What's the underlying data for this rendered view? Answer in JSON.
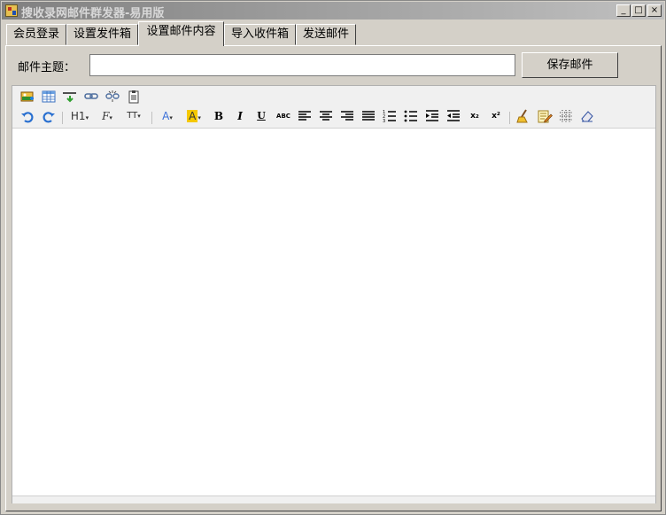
{
  "window": {
    "title": "搜收录网邮件群发器-易用版",
    "minimize_glyph": "_",
    "maximize_glyph": "□",
    "close_glyph": "×"
  },
  "tabs": [
    {
      "label": "会员登录",
      "active": false
    },
    {
      "label": "设置发件箱",
      "active": false
    },
    {
      "label": "设置邮件内容",
      "active": true
    },
    {
      "label": "导入收件箱",
      "active": false
    },
    {
      "label": "发送邮件",
      "active": false
    }
  ],
  "subject": {
    "label": "邮件主题：",
    "value": "",
    "placeholder": ""
  },
  "save_button": {
    "label": "保存邮件"
  },
  "toolbar": {
    "row1": [
      {
        "name": "insert-image-icon"
      },
      {
        "name": "insert-table-icon"
      },
      {
        "name": "insert-hr-icon"
      },
      {
        "name": "link-icon"
      },
      {
        "name": "unlink-icon"
      },
      {
        "name": "paste-icon"
      }
    ],
    "row2": {
      "heading": "H1",
      "font": "F",
      "size": "TT",
      "font_color": "A",
      "bg_color": "A",
      "bold": "B",
      "italic": "I",
      "underline": "U",
      "strike": "ABC",
      "subscript": "x₂",
      "superscript": "x²"
    },
    "colors": {
      "font_color": "#3a6fd8",
      "bg_highlight": "#f5c800"
    }
  },
  "editor": {
    "content": ""
  }
}
